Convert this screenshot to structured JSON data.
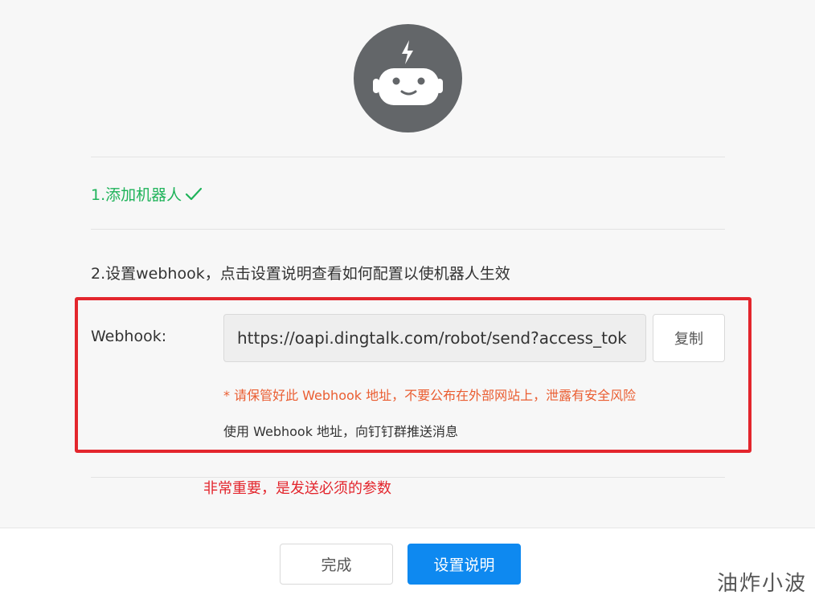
{
  "steps": {
    "step1_label": "1.添加机器人",
    "step2_label": "2.设置webhook，点击设置说明查看如何配置以使机器人生效"
  },
  "webhook": {
    "label": "Webhook:",
    "value": "https://oapi.dingtalk.com/robot/send?access_tok",
    "copy_label": "复制",
    "warning": "* 请保管好此 Webhook 地址，不要公布在外部网站上，泄露有安全风险",
    "usage": "使用 Webhook 地址，向钉钉群推送消息"
  },
  "annotation": {
    "note": "非常重要，是发送必须的参数"
  },
  "footer": {
    "done_label": "完成",
    "settings_label": "设置说明"
  },
  "watermark": "油炸小波",
  "colors": {
    "success": "#1fb35a",
    "primary": "#0e89f0",
    "warning": "#ea5d31",
    "highlight": "#e3262d",
    "avatar_bg": "#636669"
  },
  "icons": {
    "avatar": "robot-icon",
    "check": "checkmark-icon"
  }
}
